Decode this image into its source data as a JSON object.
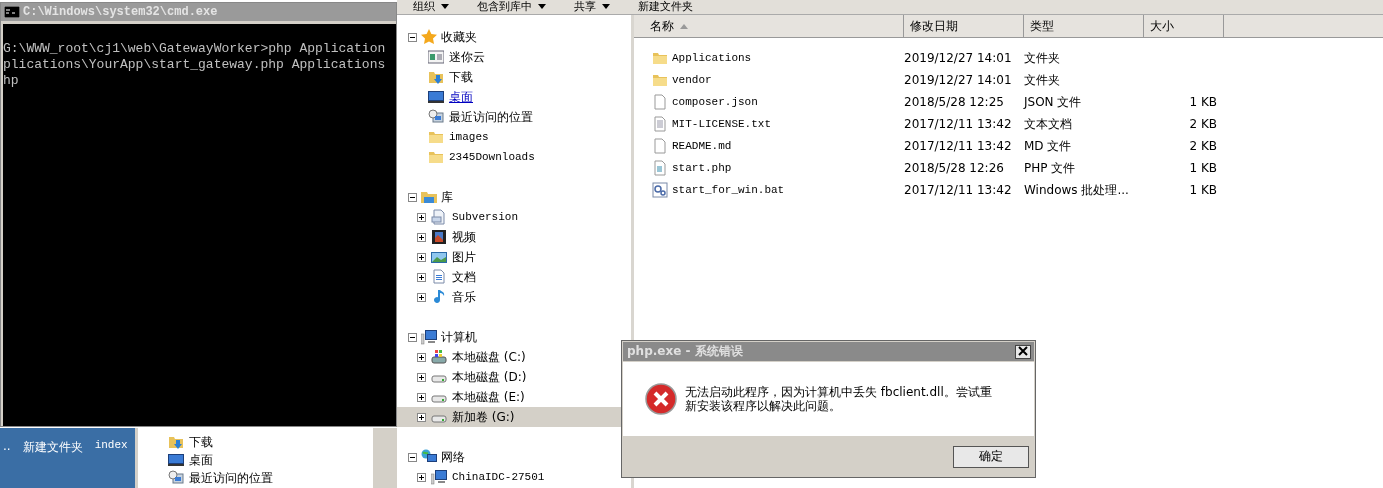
{
  "console_window": {
    "title": "C:\\Windows\\system32\\cmd.exe",
    "lines": [
      "G:\\WWW_root\\cj1\\web\\GatewayWorker>php Application",
      "plications\\YourApp\\start_gateway.php Applications",
      "hp"
    ]
  },
  "desktop": {
    "items": [
      "..",
      "新建文件夹",
      "index"
    ]
  },
  "back_window": {
    "nav_items": [
      {
        "label": "下载",
        "kind": "download"
      },
      {
        "label": "桌面",
        "kind": "desktop"
      },
      {
        "label": "最近访问的位置",
        "kind": "recent"
      }
    ]
  },
  "explorer": {
    "toolbar": [
      "组织",
      "包含到库中",
      "共享",
      "新建文件夹"
    ],
    "nav_tree": [
      {
        "label": "收藏夹",
        "kind": "star",
        "expanded": true,
        "children": [
          {
            "label": "迷你云",
            "kind": "cloud",
            "expandable": false,
            "hovered": false,
            "selected": false
          },
          {
            "label": "下载",
            "kind": "download",
            "expandable": false,
            "hovered": false,
            "selected": false
          },
          {
            "label": "桌面",
            "kind": "desktop",
            "expandable": false,
            "hovered": true,
            "selected": false
          },
          {
            "label": "最近访问的位置",
            "kind": "recent",
            "expandable": false,
            "hovered": false,
            "selected": false
          },
          {
            "label": "images",
            "kind": "folder",
            "expandable": false,
            "hovered": false,
            "selected": false
          },
          {
            "label": "2345Downloads",
            "kind": "folder",
            "expandable": false,
            "hovered": false,
            "selected": false
          }
        ]
      },
      {
        "label": "库",
        "kind": "library",
        "expanded": true,
        "children": [
          {
            "label": "Subversion",
            "kind": "svn",
            "expandable": true,
            "hovered": false,
            "selected": false
          },
          {
            "label": "视频",
            "kind": "video",
            "expandable": true,
            "hovered": false,
            "selected": false
          },
          {
            "label": "图片",
            "kind": "picture",
            "expandable": true,
            "hovered": false,
            "selected": false
          },
          {
            "label": "文档",
            "kind": "document",
            "expandable": true,
            "hovered": false,
            "selected": false
          },
          {
            "label": "音乐",
            "kind": "music",
            "expandable": true,
            "hovered": false,
            "selected": false
          }
        ]
      },
      {
        "label": "计算机",
        "kind": "computer",
        "expanded": true,
        "children": [
          {
            "label": "本地磁盘 (C:)",
            "kind": "system-drive",
            "expandable": true,
            "hovered": false,
            "selected": false
          },
          {
            "label": "本地磁盘 (D:)",
            "kind": "drive",
            "expandable": true,
            "hovered": false,
            "selected": false
          },
          {
            "label": "本地磁盘 (E:)",
            "kind": "drive",
            "expandable": true,
            "hovered": false,
            "selected": false
          },
          {
            "label": "新加卷 (G:)",
            "kind": "drive",
            "expandable": true,
            "hovered": false,
            "selected": true
          }
        ]
      },
      {
        "label": "网络",
        "kind": "network",
        "expanded": true,
        "children": [
          {
            "label": "ChinaIDC-27501",
            "kind": "computer",
            "expandable": true,
            "hovered": false,
            "selected": false
          }
        ]
      }
    ],
    "columns": [
      {
        "label": "名称",
        "sorted": true
      },
      {
        "label": "修改日期",
        "sorted": false
      },
      {
        "label": "类型",
        "sorted": false
      },
      {
        "label": "大小",
        "sorted": false
      }
    ],
    "files": [
      {
        "name": "Applications",
        "kind": "folder",
        "modified": "2019/12/27 14:01",
        "type": "文件夹"
      },
      {
        "name": "vendor",
        "kind": "folder",
        "modified": "2019/12/27 14:01",
        "type": "文件夹"
      },
      {
        "name": "composer.json",
        "kind": "file",
        "modified": "2018/5/28 12:25",
        "type": "JSON 文件",
        "size": "1 KB"
      },
      {
        "name": "MIT-LICENSE.txt",
        "kind": "text",
        "modified": "2017/12/11 13:42",
        "type": "文本文档",
        "size": "2 KB"
      },
      {
        "name": "README.md",
        "kind": "file",
        "modified": "2017/12/11 13:42",
        "type": "MD 文件",
        "size": "2 KB"
      },
      {
        "name": "start.php",
        "kind": "php",
        "modified": "2018/5/28 12:26",
        "type": "PHP 文件",
        "size": "1 KB"
      },
      {
        "name": "start_for_win.bat",
        "kind": "bat",
        "modified": "2017/12/11 13:42",
        "type": "Windows 批处理...",
        "size": "1 KB"
      }
    ]
  },
  "dialog": {
    "title": "php.exe - 系统错误",
    "message": "无法启动此程序，因为计算机中丢失 fbclient.dll。尝试重新安装该程序以解决此问题。",
    "button": "确定"
  }
}
